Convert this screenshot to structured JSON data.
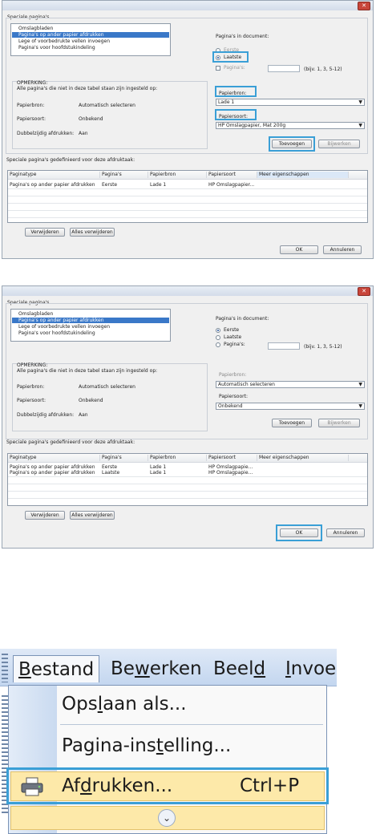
{
  "dialog1": {
    "special_pages_label": "Speciale pagina's",
    "list_items": [
      "Omslagbladen",
      "Pagina's op ander papier afdrukken",
      "Lege of voorbedrukte vellen invoegen",
      "Pagina's voor hoofdstukindeling"
    ],
    "pages_in_doc_label": "Pagina's in document:",
    "radio_first": "Eerste",
    "radio_last": "Laatste",
    "radio_pages": "Pagina's:",
    "pages_hint": "(bijv. 1, 3, 5-12)",
    "note_title": "OPMERKING:",
    "note_text": "Alle pagina's die niet in deze tabel staan zijn ingesteld op:",
    "paper_source_label": "Papierbron:",
    "paper_source_value": "Automatisch selecteren",
    "paper_type_label": "Papiersoort:",
    "paper_type_value": "Onbekend",
    "duplex_label": "Dubbelzijdig afdrukken:",
    "duplex_value": "Aan",
    "source_field_label": "Papierbron:",
    "source_select": "Lade 1",
    "type_field_label": "Papiersoort:",
    "type_select": "HP Omslagpapier, Mat 200g",
    "add_button": "Toevoegen",
    "edit_button": "Bijwerken",
    "table_caption": "Speciale pagina's gedefinieerd voor deze afdruktaak:",
    "columns": [
      "Paginatype",
      "Pagina's",
      "Papierbron",
      "Papiersoort",
      "Meer eigenschappen"
    ],
    "rows": [
      [
        "Pagina's op ander papier afdrukken",
        "Eerste",
        "Lade 1",
        "HP Omslagpapier...",
        ""
      ]
    ],
    "delete_button": "Verwijderen",
    "delete_all_button": "Alles verwijderen",
    "ok_button": "OK",
    "cancel_button": "Annuleren"
  },
  "dialog2": {
    "special_pages_label": "Speciale pagina's",
    "list_items": [
      "Omslagbladen",
      "Pagina's op ander papier afdrukken",
      "Lege of voorbedrukte vellen invoegen",
      "Pagina's voor hoofdstukindeling"
    ],
    "pages_in_doc_label": "Pagina's in document:",
    "radio_first": "Eerste",
    "radio_last": "Laatste",
    "radio_pages": "Pagina's:",
    "pages_hint": "(bijv. 1, 3, 5-12)",
    "note_title": "OPMERKING:",
    "note_text": "Alle pagina's die niet in deze tabel staan zijn ingesteld op:",
    "paper_source_label": "Papierbron:",
    "paper_source_value": "Automatisch selecteren",
    "paper_type_label": "Papiersoort:",
    "paper_type_value": "Onbekend",
    "duplex_label": "Dubbelzijdig afdrukken:",
    "duplex_value": "Aan",
    "source_field_label": "Papierbron:",
    "source_select": "Automatisch selecteren",
    "type_field_label": "Papiersoort:",
    "type_select": "Onbekend",
    "add_button": "Toevoegen",
    "edit_button": "Bijwerken",
    "table_caption": "Speciale pagina's gedefinieerd voor deze afdruktaak:",
    "columns": [
      "Paginatype",
      "Pagina's",
      "Papierbron",
      "Papiersoort",
      "Meer eigenschappen"
    ],
    "rows": [
      [
        "Pagina's op ander papier afdrukken",
        "Eerste",
        "Lade 1",
        "HP Omslagpapie...",
        ""
      ],
      [
        "Pagina's op ander papier afdrukken",
        "Laatste",
        "Lade 1",
        "HP Omslagpapie...",
        ""
      ]
    ],
    "delete_button": "Verwijderen",
    "delete_all_button": "Alles verwijderen",
    "ok_button": "OK",
    "cancel_button": "Annuleren"
  },
  "menu": {
    "bar": {
      "bestand": {
        "pre": "",
        "u": "B",
        "post": "estand"
      },
      "bewerken": {
        "pre": "Be",
        "u": "w",
        "post": "erken"
      },
      "beeld": {
        "pre": "Beel",
        "u": "d",
        "post": ""
      },
      "invoegen": {
        "pre": "",
        "u": "I",
        "post": "nvoe"
      }
    },
    "items": {
      "save_as": {
        "pre": "Ops",
        "u": "l",
        "post": "aan als..."
      },
      "page_setup": {
        "pre": "Pagina-ins",
        "u": "t",
        "post": "elling..."
      },
      "print": {
        "pre": "Af",
        "u": "d",
        "post": "rukken...",
        "shortcut": "Ctrl+P"
      }
    },
    "expand_icon": "double-chevron-down-icon",
    "print_icon": "printer-icon"
  },
  "colors": {
    "highlight": "#3a9fd6",
    "selection": "#3a78c8",
    "menu_hover": "#fde9a9"
  }
}
